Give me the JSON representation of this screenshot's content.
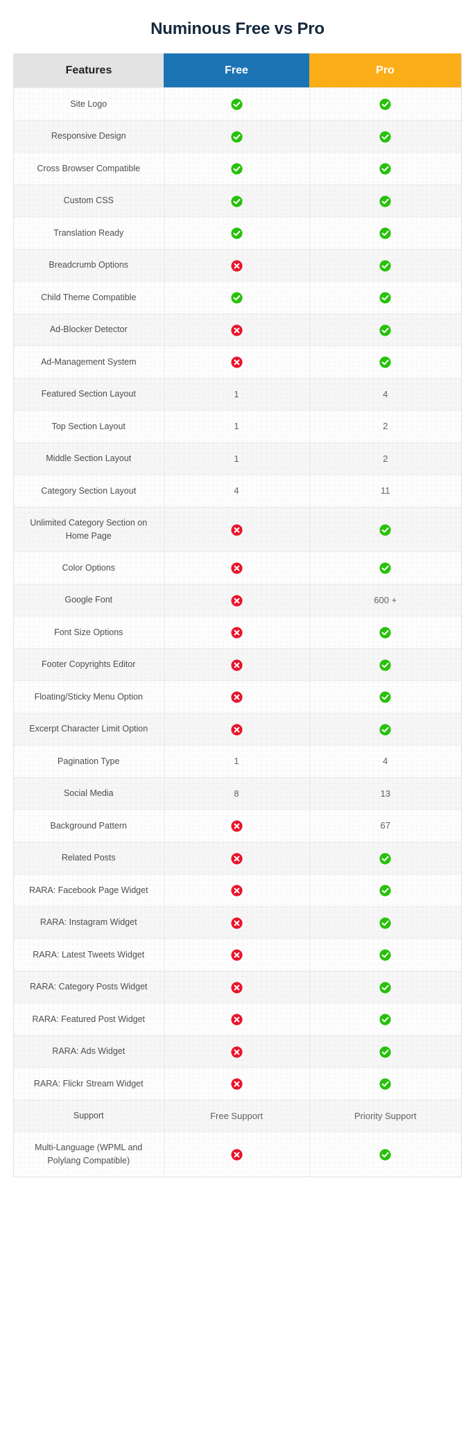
{
  "page": {
    "title": "Numinous Free vs Pro",
    "title_color": "#14293d",
    "background": "#ffffff"
  },
  "table": {
    "columns": [
      {
        "key": "feature",
        "label": "Features",
        "bg": "#e3e3e3",
        "fg": "#222222"
      },
      {
        "key": "free",
        "label": "Free",
        "bg": "#1d74b4",
        "fg": "#ffffff"
      },
      {
        "key": "pro",
        "label": "Pro",
        "bg": "#fbae17",
        "fg": "#ffffff"
      }
    ],
    "icons": {
      "yes": {
        "name": "check-circle-icon",
        "color": "#27c10a",
        "glyph": "check"
      },
      "no": {
        "name": "x-circle-icon",
        "color": "#e8142a",
        "glyph": "cross"
      }
    },
    "rows": [
      {
        "feature": "Site Logo",
        "free": {
          "type": "icon",
          "value": "yes"
        },
        "pro": {
          "type": "icon",
          "value": "yes"
        }
      },
      {
        "feature": "Responsive Design",
        "free": {
          "type": "icon",
          "value": "yes"
        },
        "pro": {
          "type": "icon",
          "value": "yes"
        }
      },
      {
        "feature": "Cross Browser Compatible",
        "free": {
          "type": "icon",
          "value": "yes"
        },
        "pro": {
          "type": "icon",
          "value": "yes"
        }
      },
      {
        "feature": "Custom CSS",
        "free": {
          "type": "icon",
          "value": "yes"
        },
        "pro": {
          "type": "icon",
          "value": "yes"
        }
      },
      {
        "feature": "Translation Ready",
        "free": {
          "type": "icon",
          "value": "yes"
        },
        "pro": {
          "type": "icon",
          "value": "yes"
        }
      },
      {
        "feature": "Breadcrumb Options",
        "free": {
          "type": "icon",
          "value": "no"
        },
        "pro": {
          "type": "icon",
          "value": "yes"
        }
      },
      {
        "feature": "Child Theme Compatible",
        "free": {
          "type": "icon",
          "value": "yes"
        },
        "pro": {
          "type": "icon",
          "value": "yes"
        }
      },
      {
        "feature": "Ad-Blocker Detector",
        "free": {
          "type": "icon",
          "value": "no"
        },
        "pro": {
          "type": "icon",
          "value": "yes"
        }
      },
      {
        "feature": "Ad-Management System",
        "free": {
          "type": "icon",
          "value": "no"
        },
        "pro": {
          "type": "icon",
          "value": "yes"
        }
      },
      {
        "feature": "Featured Section Layout",
        "free": {
          "type": "text",
          "value": "1"
        },
        "pro": {
          "type": "text",
          "value": "4"
        }
      },
      {
        "feature": "Top Section Layout",
        "free": {
          "type": "text",
          "value": "1"
        },
        "pro": {
          "type": "text",
          "value": "2"
        }
      },
      {
        "feature": "Middle Section Layout",
        "free": {
          "type": "text",
          "value": "1"
        },
        "pro": {
          "type": "text",
          "value": "2"
        }
      },
      {
        "feature": "Category Section Layout",
        "free": {
          "type": "text",
          "value": "4"
        },
        "pro": {
          "type": "text",
          "value": "11"
        }
      },
      {
        "feature": "Unlimited Category Section on Home Page",
        "free": {
          "type": "icon",
          "value": "no"
        },
        "pro": {
          "type": "icon",
          "value": "yes"
        }
      },
      {
        "feature": "Color Options",
        "free": {
          "type": "icon",
          "value": "no"
        },
        "pro": {
          "type": "icon",
          "value": "yes"
        }
      },
      {
        "feature": "Google Font",
        "free": {
          "type": "icon",
          "value": "no"
        },
        "pro": {
          "type": "text",
          "value": "600 +"
        }
      },
      {
        "feature": "Font Size Options",
        "free": {
          "type": "icon",
          "value": "no"
        },
        "pro": {
          "type": "icon",
          "value": "yes"
        }
      },
      {
        "feature": "Footer Copyrights Editor",
        "free": {
          "type": "icon",
          "value": "no"
        },
        "pro": {
          "type": "icon",
          "value": "yes"
        }
      },
      {
        "feature": "Floating/Sticky Menu Option",
        "free": {
          "type": "icon",
          "value": "no"
        },
        "pro": {
          "type": "icon",
          "value": "yes"
        }
      },
      {
        "feature": "Excerpt Character Limit Option",
        "free": {
          "type": "icon",
          "value": "no"
        },
        "pro": {
          "type": "icon",
          "value": "yes"
        }
      },
      {
        "feature": "Pagination Type",
        "free": {
          "type": "text",
          "value": "1"
        },
        "pro": {
          "type": "text",
          "value": "4"
        }
      },
      {
        "feature": "Social Media",
        "free": {
          "type": "text",
          "value": "8"
        },
        "pro": {
          "type": "text",
          "value": "13"
        }
      },
      {
        "feature": "Background Pattern",
        "free": {
          "type": "icon",
          "value": "no"
        },
        "pro": {
          "type": "text",
          "value": "67"
        }
      },
      {
        "feature": "Related Posts",
        "free": {
          "type": "icon",
          "value": "no"
        },
        "pro": {
          "type": "icon",
          "value": "yes"
        }
      },
      {
        "feature": "RARA: Facebook Page Widget",
        "free": {
          "type": "icon",
          "value": "no"
        },
        "pro": {
          "type": "icon",
          "value": "yes"
        }
      },
      {
        "feature": "RARA: Instagram Widget",
        "free": {
          "type": "icon",
          "value": "no"
        },
        "pro": {
          "type": "icon",
          "value": "yes"
        }
      },
      {
        "feature": "RARA: Latest Tweets Widget",
        "free": {
          "type": "icon",
          "value": "no"
        },
        "pro": {
          "type": "icon",
          "value": "yes"
        }
      },
      {
        "feature": "RARA: Category Posts Widget",
        "free": {
          "type": "icon",
          "value": "no"
        },
        "pro": {
          "type": "icon",
          "value": "yes"
        }
      },
      {
        "feature": "RARA: Featured Post Widget",
        "free": {
          "type": "icon",
          "value": "no"
        },
        "pro": {
          "type": "icon",
          "value": "yes"
        }
      },
      {
        "feature": "RARA: Ads Widget",
        "free": {
          "type": "icon",
          "value": "no"
        },
        "pro": {
          "type": "icon",
          "value": "yes"
        }
      },
      {
        "feature": "RARA: Flickr Stream Widget",
        "free": {
          "type": "icon",
          "value": "no"
        },
        "pro": {
          "type": "icon",
          "value": "yes"
        }
      },
      {
        "feature": "Support",
        "free": {
          "type": "text",
          "value": "Free Support"
        },
        "pro": {
          "type": "text",
          "value": "Priority Support"
        }
      },
      {
        "feature": "Multi-Language (WPML and Polylang Compatible)",
        "free": {
          "type": "icon",
          "value": "no"
        },
        "pro": {
          "type": "icon",
          "value": "yes"
        }
      }
    ]
  }
}
